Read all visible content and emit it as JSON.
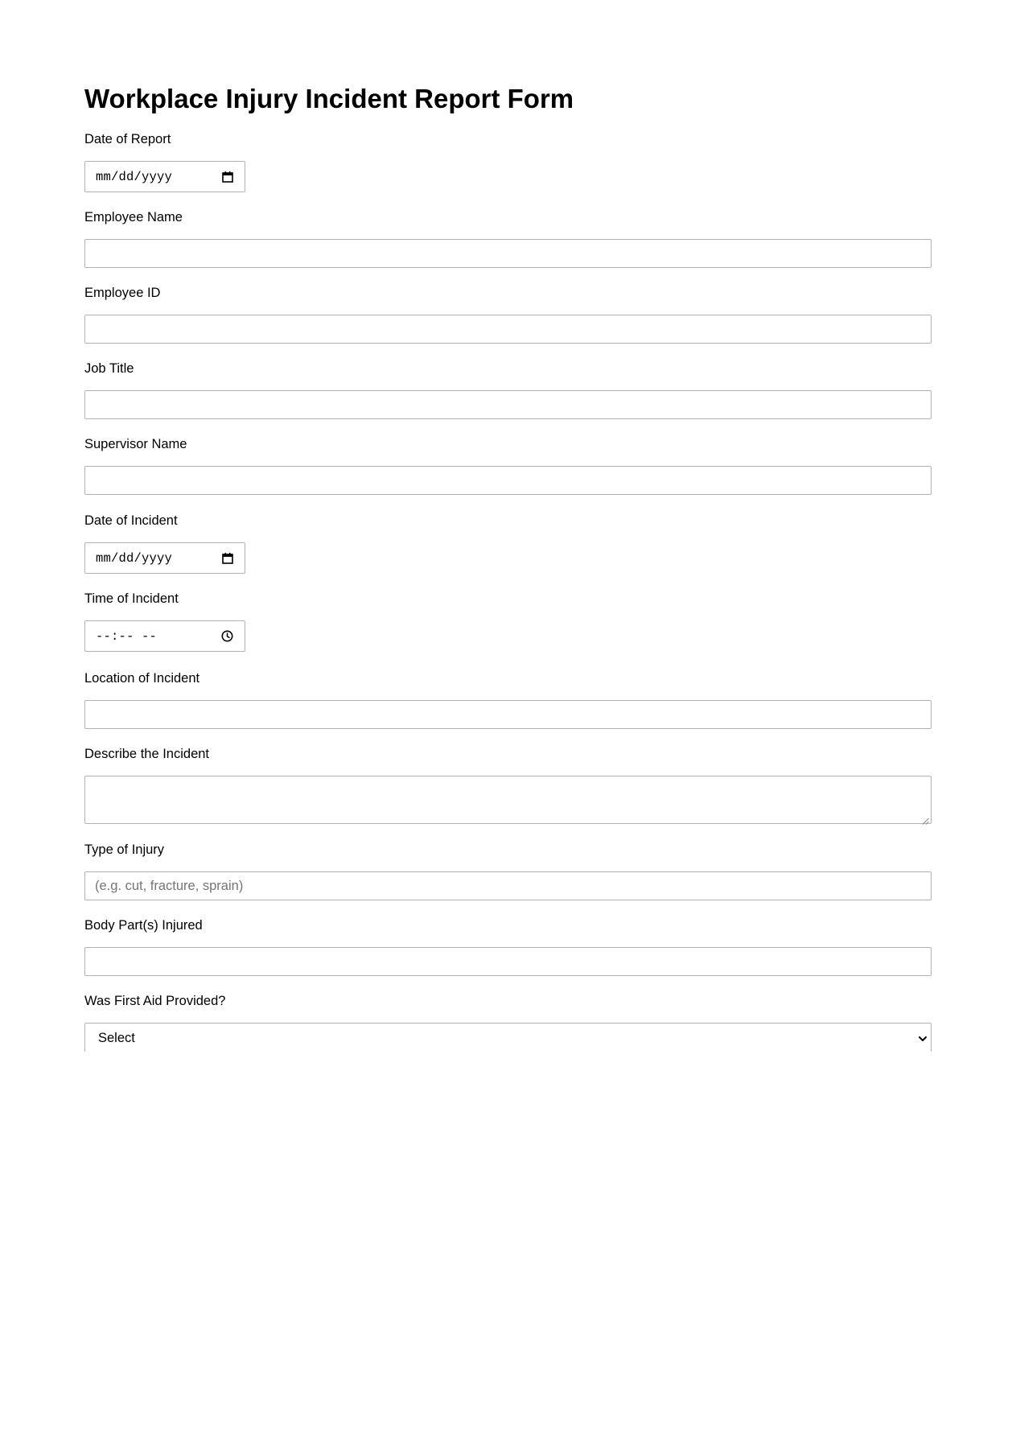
{
  "form": {
    "title": "Workplace Injury Incident Report Form",
    "fields": {
      "date_of_report": {
        "label": "Date of Report",
        "value": "mm/dd/yyyy"
      },
      "employee_name": {
        "label": "Employee Name",
        "value": ""
      },
      "employee_id": {
        "label": "Employee ID",
        "value": ""
      },
      "job_title": {
        "label": "Job Title",
        "value": ""
      },
      "supervisor_name": {
        "label": "Supervisor Name",
        "value": ""
      },
      "date_of_incident": {
        "label": "Date of Incident",
        "value": "mm/dd/yyyy"
      },
      "time_of_incident": {
        "label": "Time of Incident",
        "value": "--:-- --"
      },
      "location_of_incident": {
        "label": "Location of Incident",
        "value": ""
      },
      "describe_incident": {
        "label": "Describe the Incident",
        "value": ""
      },
      "type_of_injury": {
        "label": "Type of Injury",
        "placeholder": "(e.g. cut, fracture, sprain)",
        "value": ""
      },
      "body_parts_injured": {
        "label": "Body Part(s) Injured",
        "value": ""
      },
      "first_aid_provided": {
        "label": "Was First Aid Provided?",
        "selected": "Select"
      }
    }
  },
  "icons": {
    "date_picker": "calendar-icon",
    "time_picker": "clock-icon",
    "dropdown": "chevron-down-icon",
    "textarea_resize": "resize-grip-icon"
  },
  "colors": {
    "border": "#b3b3b3",
    "placeholder": "#757575",
    "text": "#000000"
  }
}
